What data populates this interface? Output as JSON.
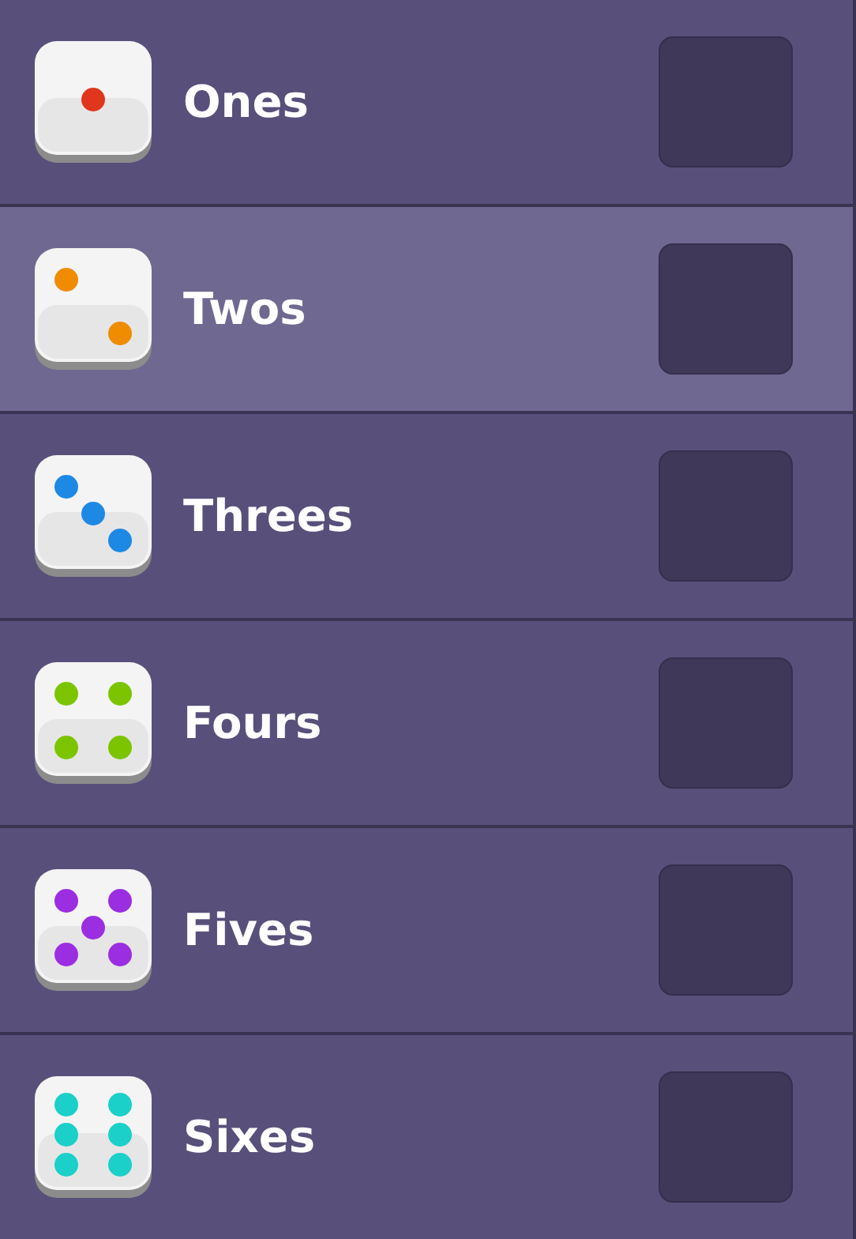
{
  "rows": [
    {
      "label": "Ones",
      "kind": "one",
      "color": "#e0361e",
      "selected": false
    },
    {
      "label": "Twos",
      "kind": "two",
      "color": "#f08c00",
      "selected": true
    },
    {
      "label": "Threes",
      "kind": "three",
      "color": "#1e88e5",
      "selected": false
    },
    {
      "label": "Fours",
      "kind": "four",
      "color": "#7cc400",
      "selected": false
    },
    {
      "label": "Fives",
      "kind": "five",
      "color": "#9a2ee0",
      "selected": false
    },
    {
      "label": "Sixes",
      "kind": "six",
      "color": "#1ad0c8",
      "selected": false
    }
  ]
}
